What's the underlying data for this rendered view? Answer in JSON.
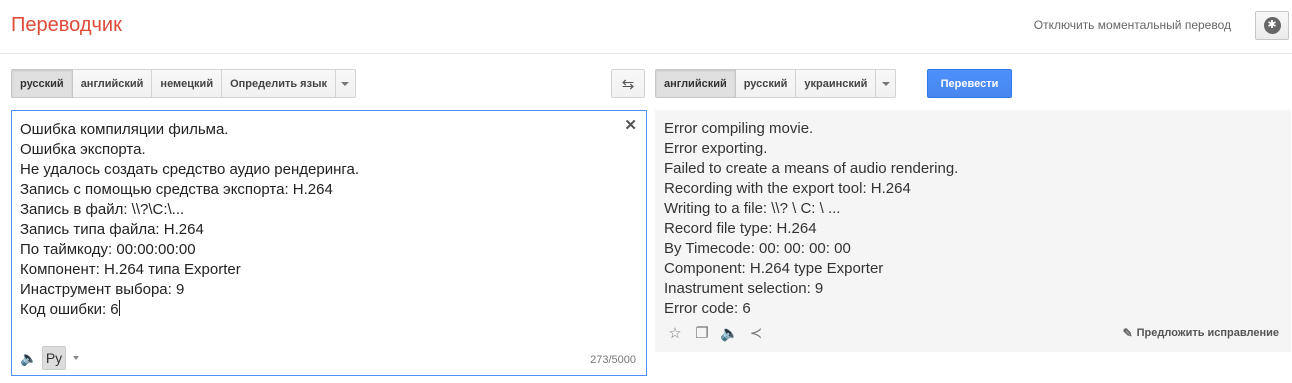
{
  "header": {
    "title": "Переводчик",
    "instant_off": "Отключить моментальный перевод",
    "settings_icon": "gear-icon"
  },
  "source_langs": {
    "items": [
      "русский",
      "английский",
      "немецкий",
      "Определить язык"
    ],
    "active_index": 0
  },
  "target_langs": {
    "items": [
      "английский",
      "русский",
      "украинский"
    ],
    "active_index": 0
  },
  "swap_icon": "swap-arrows-icon",
  "translate_label": "Перевести",
  "source": {
    "text": "Ошибка компиляции фильма.\nОшибка экспорта.\nНе удалось создать средство аудио рендеринга.\nЗапись с помощью средства экспорта: H.264\nЗапись в файл: \\\\?\\C:\\...\nЗапись типа файла: H.264\nПо таймкоду: 00:00:00:00\nКомпонент: H.264 типа Exporter\nИнаструмент выбора: 9\nКод ошибки: 6",
    "clear_glyph": "✕",
    "input_lang": "Ру",
    "counter": "273/5000"
  },
  "result": {
    "text": "Error compiling movie.\nError exporting.\nFailed to create a means of audio rendering.\nRecording with the export tool: H.264\nWriting to a file: \\\\? \\ C: \\ ...\nRecord file type: H.264\nBy Timecode: 00: 00: 00: 00\nComponent: H.264 type Exporter\nInastrument selection: 9\nError code: 6",
    "suggest": "Предложить исправление"
  },
  "colors": {
    "title": "#dd4b39",
    "accent": "#4d90fe",
    "result_bg": "#f5f5f5"
  }
}
